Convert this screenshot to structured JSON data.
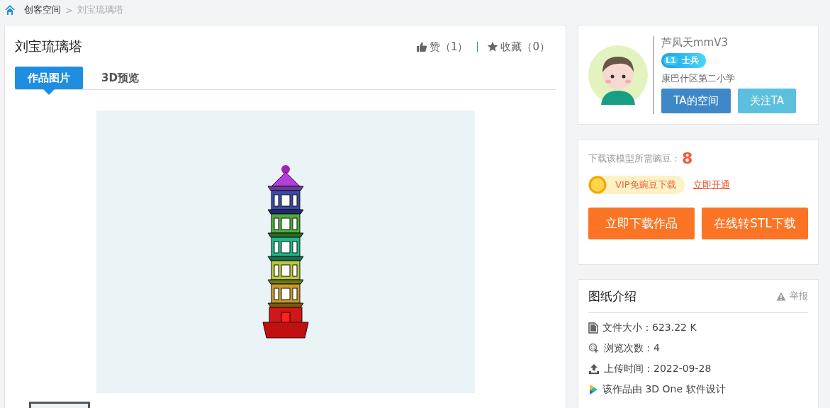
{
  "breadcrumb_separator": ">",
  "breadcrumb": [
    {
      "label": "创客空间",
      "current": false
    },
    {
      "label": "刘宝琉璃塔",
      "current": true
    }
  ],
  "work": {
    "title": "刘宝琉璃塔",
    "like": "赞（1）",
    "favorite": "收藏（0）",
    "tabs": [
      {
        "label": "作品图片",
        "selected": true
      },
      {
        "label": "3D预览",
        "selected": false
      }
    ]
  },
  "author": {
    "name": "芦凤天mmV3",
    "level": "L1",
    "rank": "士兵",
    "school": "康巴什区第二小学",
    "buttons": [
      {
        "label": "TA的空间",
        "kind": "primary"
      },
      {
        "label": "关注TA",
        "kind": "secondary"
      }
    ]
  },
  "download": {
    "cost_label": "下载该模型所需豌豆：",
    "cost": "8",
    "vip_label": "VIP免豌豆下载",
    "vip_link": "立即开通",
    "buttons": [
      {
        "label": "立即下载作品"
      },
      {
        "label": "在线转STL下载"
      }
    ]
  },
  "info": {
    "title": "图纸介绍",
    "report": "举报",
    "items": [
      {
        "kind": "file",
        "text": "文件大小：623.22 K"
      },
      {
        "kind": "views",
        "text": "浏览次数：4"
      },
      {
        "kind": "upload",
        "text": "上传时间：2022-09-28"
      },
      {
        "kind": "software",
        "text": "该作品由 3D One 软件设计"
      }
    ]
  }
}
